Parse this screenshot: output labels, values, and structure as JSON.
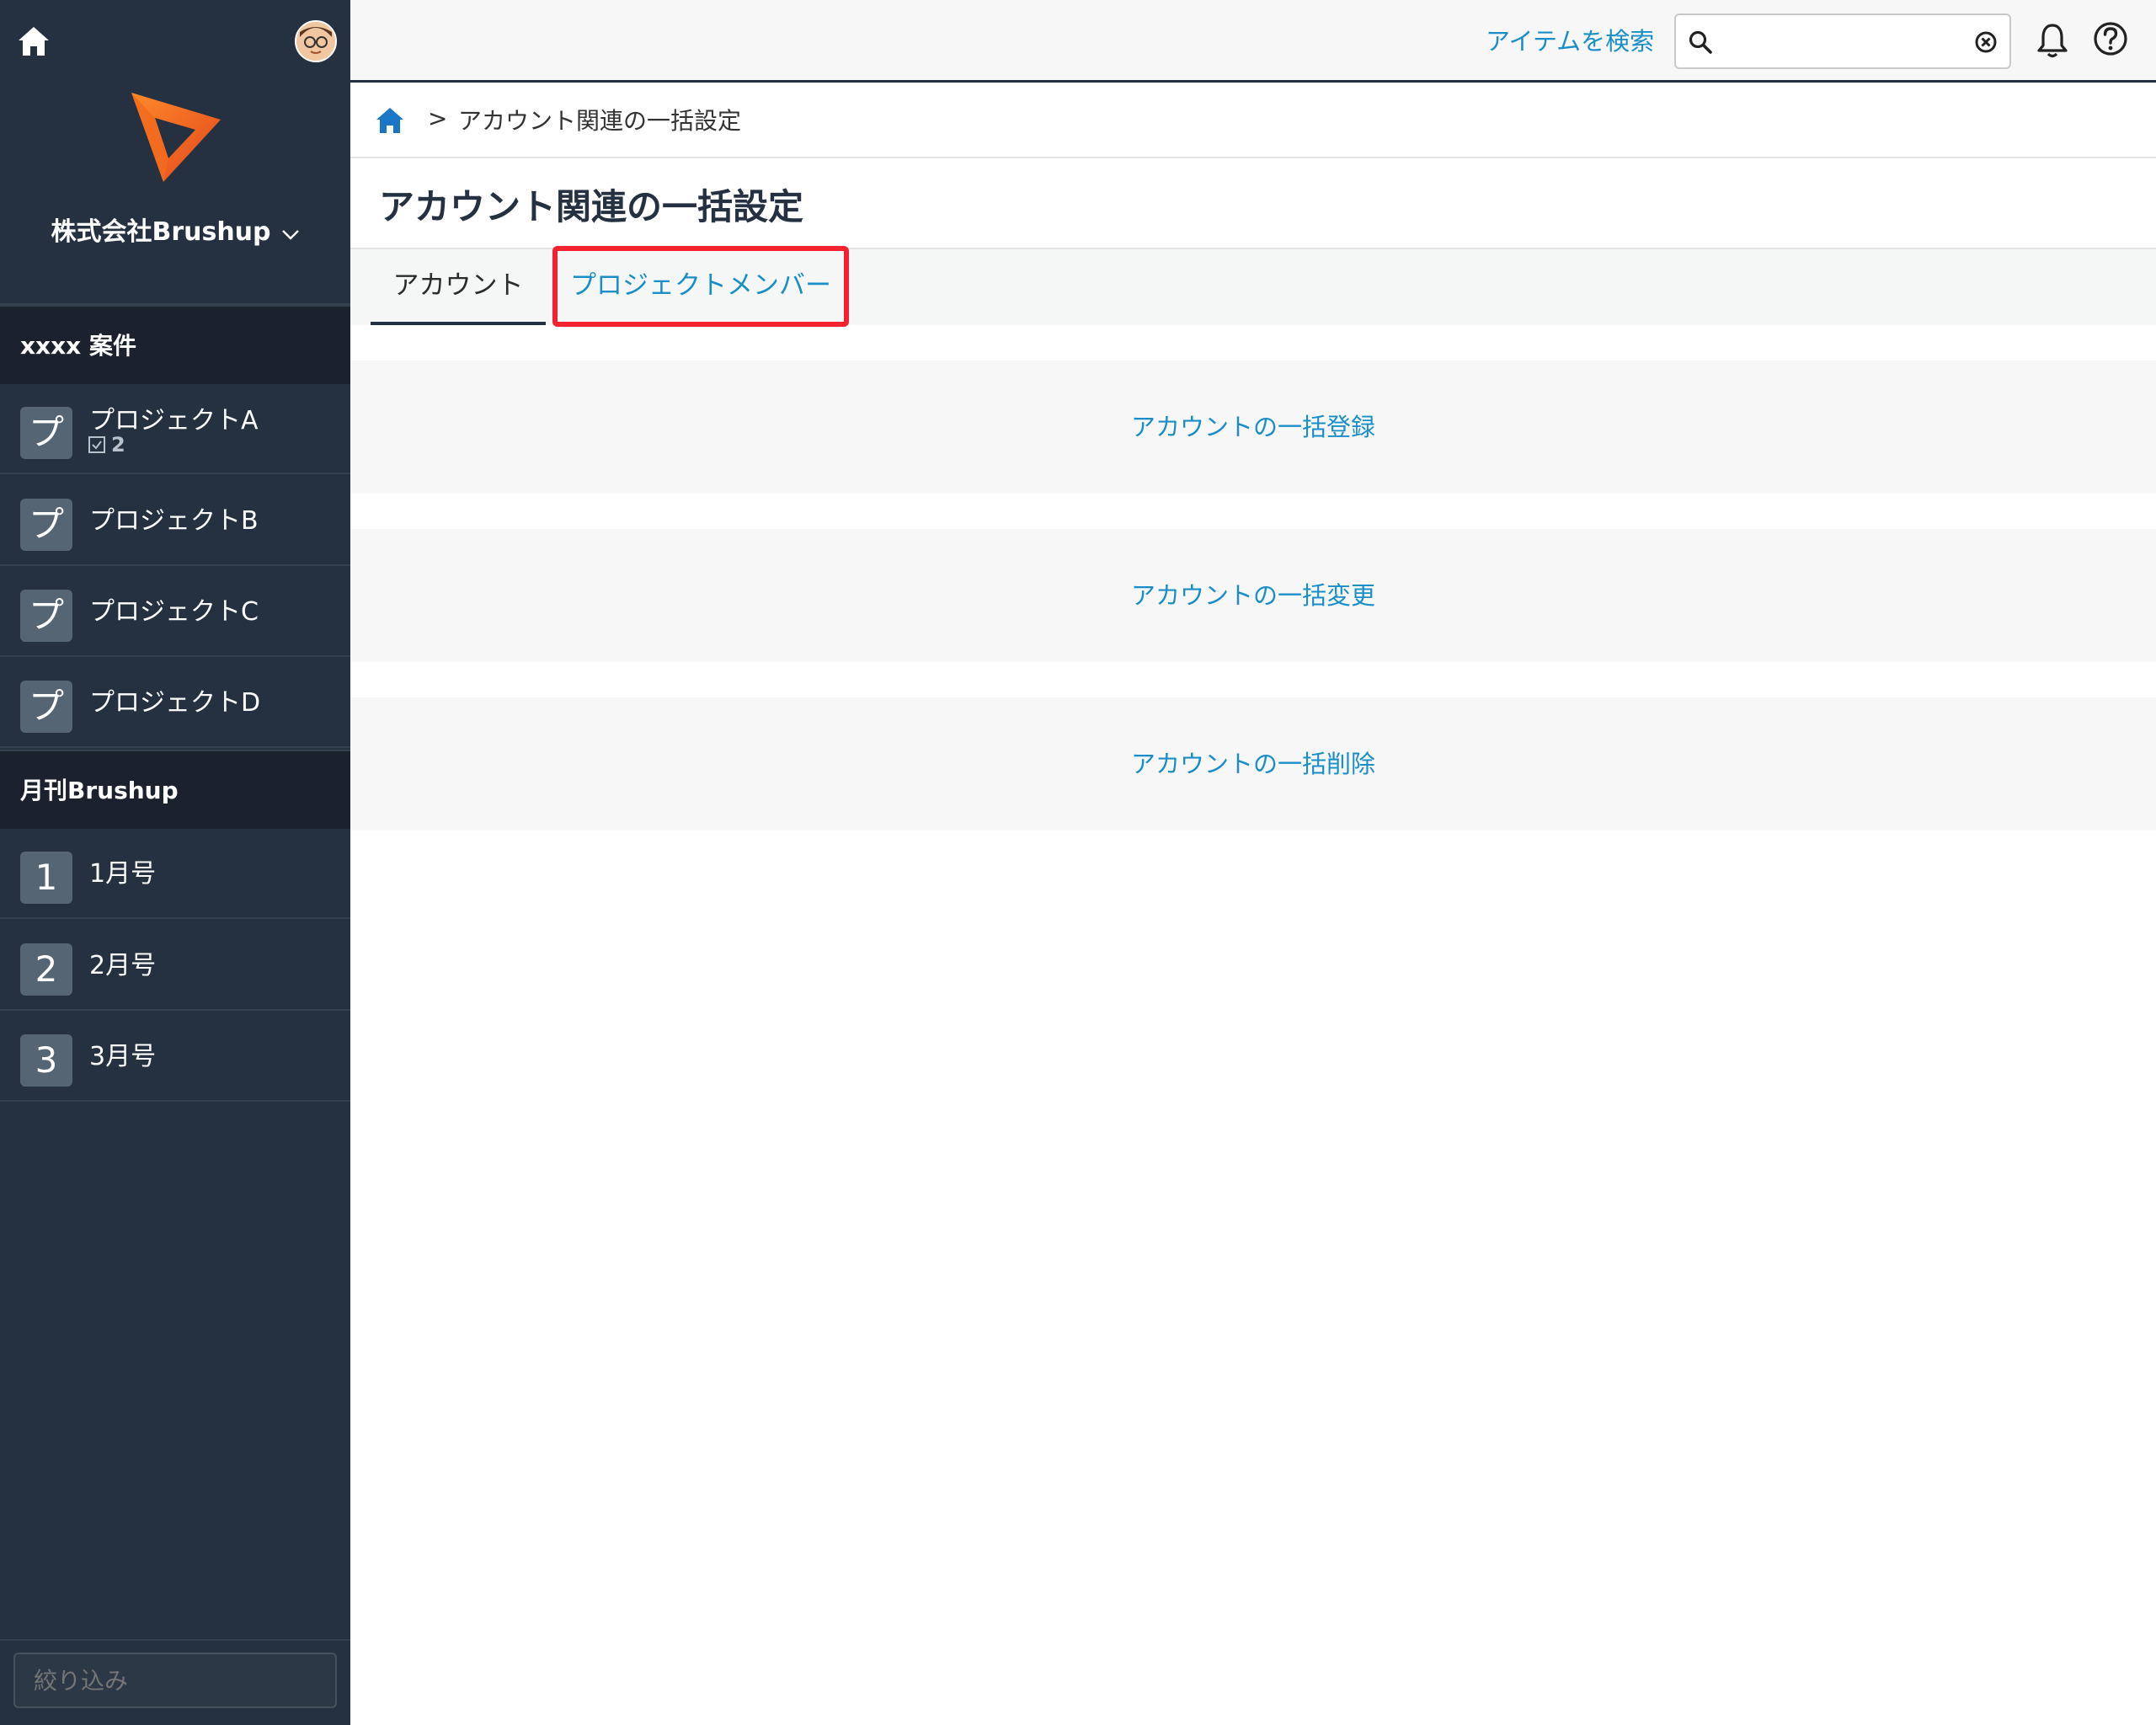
{
  "sidebar": {
    "org_name": "株式会社Brushup",
    "groups": [
      {
        "title": "xxxx 案件",
        "items": [
          {
            "badge": "プ",
            "label": "プロジェクトA",
            "meta": "2"
          },
          {
            "badge": "プ",
            "label": "プロジェクトB"
          },
          {
            "badge": "プ",
            "label": "プロジェクトC"
          },
          {
            "badge": "プ",
            "label": "プロジェクトD"
          }
        ]
      },
      {
        "title": "月刊Brushup",
        "items": [
          {
            "badge": "1",
            "label": "1月号"
          },
          {
            "badge": "2",
            "label": "2月号"
          },
          {
            "badge": "3",
            "label": "3月号"
          }
        ]
      }
    ],
    "filter_placeholder": "絞り込み"
  },
  "topbar": {
    "search_link": "アイテムを検索",
    "search_value": ""
  },
  "breadcrumb": {
    "separator": ">",
    "current": "アカウント関連の一括設定"
  },
  "page": {
    "title": "アカウント関連の一括設定",
    "tabs": [
      {
        "label": "アカウント",
        "active": true
      },
      {
        "label": "プロジェクトメンバー",
        "active": false,
        "highlighted": true
      }
    ],
    "actions": [
      {
        "label": "アカウントの一括登録"
      },
      {
        "label": "アカウントの一括変更"
      },
      {
        "label": "アカウントの一括削除"
      }
    ]
  },
  "colors": {
    "sidebar_bg": "#253140",
    "sidebar_header_bg": "#1b222d",
    "link": "#1a8fc7",
    "highlight": "#f5222d",
    "logo_orange": "#f26b1d"
  }
}
